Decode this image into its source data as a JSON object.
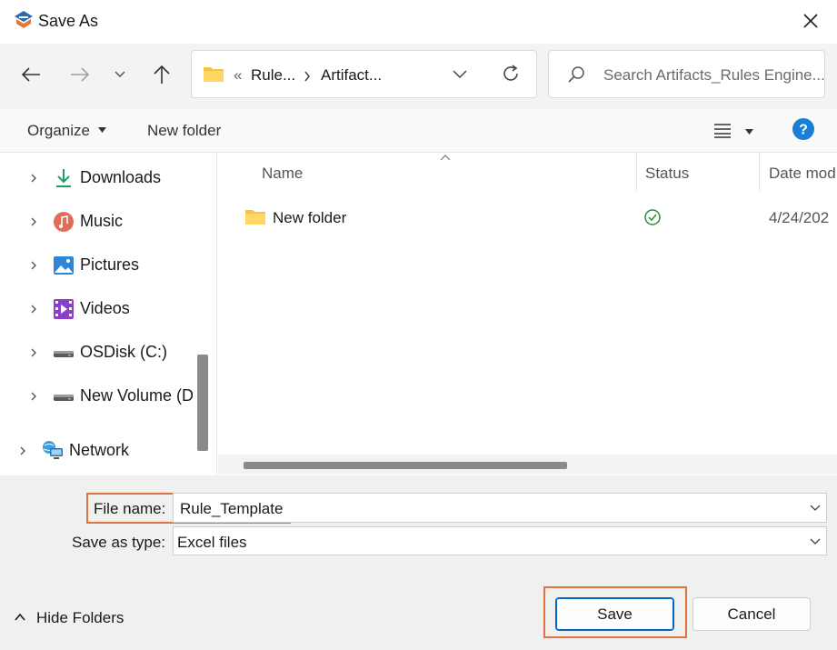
{
  "window": {
    "title": "Save As"
  },
  "nav": {
    "breadcrumb_sep": "«",
    "crumbs": [
      "Rule...",
      "Artifact..."
    ],
    "search_placeholder": "Search Artifacts_Rules Engine..."
  },
  "toolbar": {
    "organize_label": "Organize",
    "new_folder_label": "New folder"
  },
  "sidebar": {
    "items": [
      {
        "label": "Downloads",
        "icon": "download-icon"
      },
      {
        "label": "Music",
        "icon": "music-icon"
      },
      {
        "label": "Pictures",
        "icon": "pictures-icon"
      },
      {
        "label": "Videos",
        "icon": "videos-icon"
      },
      {
        "label": "OSDisk (C:)",
        "icon": "drive-icon"
      },
      {
        "label": "New Volume (D",
        "icon": "drive-icon"
      },
      {
        "label": "Network",
        "icon": "network-icon"
      }
    ]
  },
  "filelist": {
    "columns": [
      "Name",
      "Status",
      "Date mod"
    ],
    "rows": [
      {
        "name": "New folder",
        "status": "synced",
        "date": "4/24/202"
      }
    ]
  },
  "form": {
    "filename_label": "File name:",
    "filename_value": "Rule_Template",
    "type_label": "Save as type:",
    "type_value": "Excel files"
  },
  "footer": {
    "hide_folders_label": "Hide Folders",
    "save_label": "Save",
    "cancel_label": "Cancel"
  },
  "colors": {
    "accent": "#0067c0",
    "highlight": "#e0733d",
    "folder": "#f5c342",
    "help": "#1a7fd4",
    "status_ok": "#2e8b3a"
  }
}
